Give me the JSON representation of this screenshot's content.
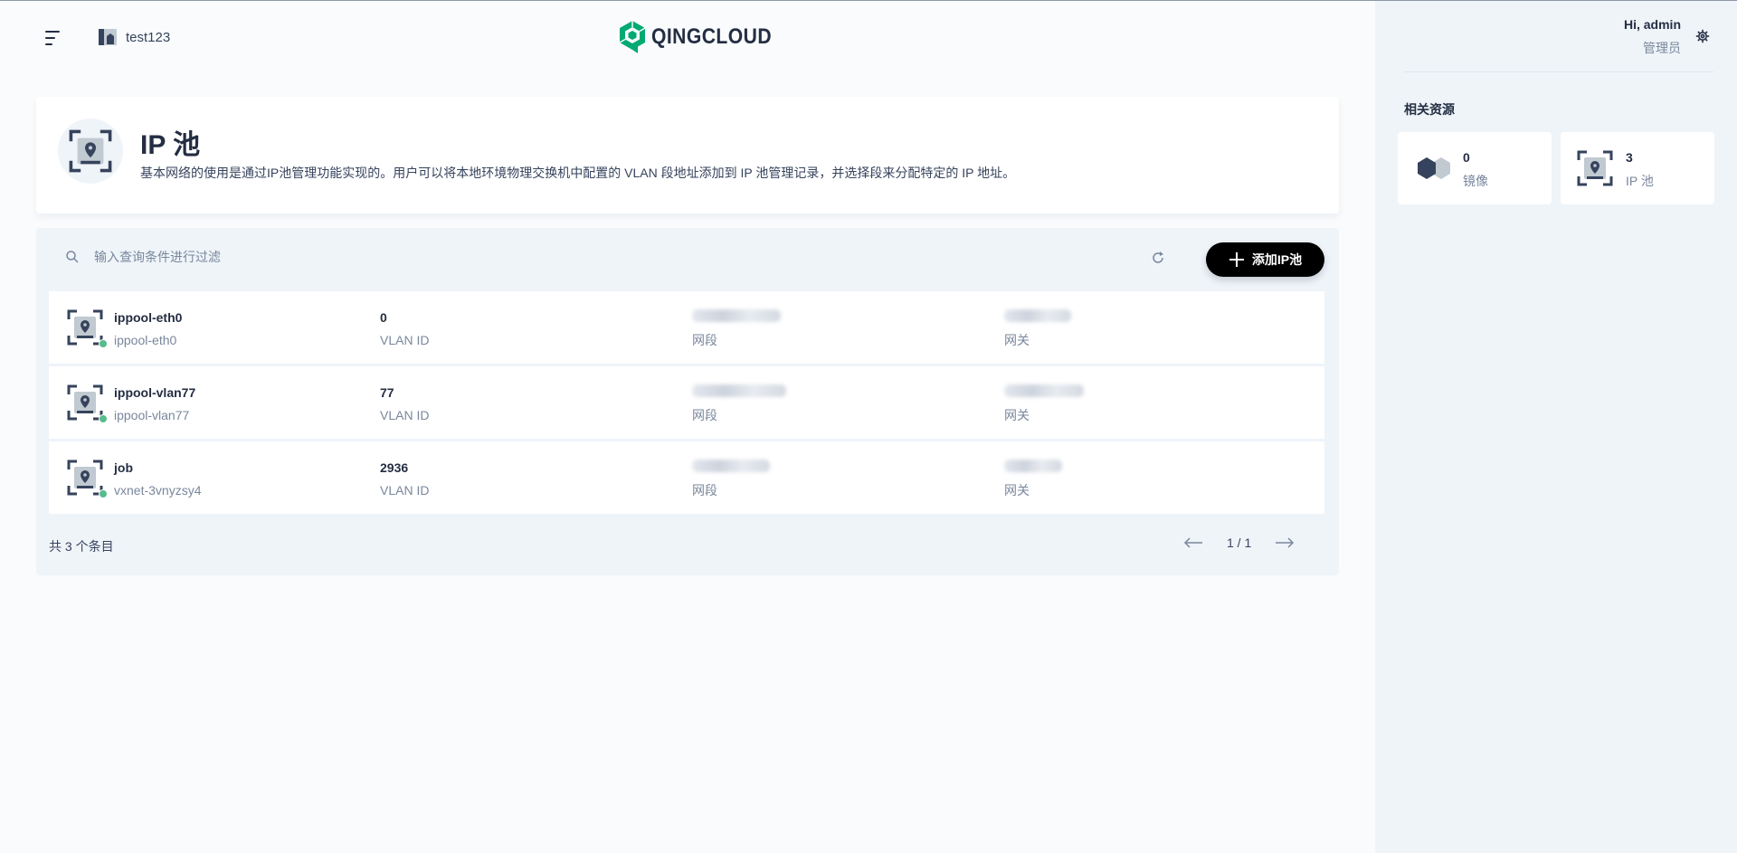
{
  "header": {
    "workspace": "test123",
    "logo_text": "QINGCLOUD"
  },
  "banner": {
    "title": "IP 池",
    "description": "基本网络的使用是通过IP池管理功能实现的。用户可以将本地环境物理交换机中配置的 VLAN 段地址添加到 IP 池管理记录，并选择段来分配特定的 IP 地址。"
  },
  "toolbar": {
    "search_placeholder": "输入查询条件进行过滤",
    "add_label": "添加IP池"
  },
  "columns": {
    "vlan": "VLAN ID",
    "segment": "网段",
    "gateway": "网关"
  },
  "rows": [
    {
      "name": "ippool-eth0",
      "sub": "ippool-eth0",
      "vlan": "0",
      "status": "active"
    },
    {
      "name": "ippool-vlan77",
      "sub": "ippool-vlan77",
      "vlan": "77",
      "status": "active"
    },
    {
      "name": "job",
      "sub": "vxnet-3vnyzsy4",
      "vlan": "2936",
      "status": "active"
    }
  ],
  "footer": {
    "total": "共 3 个条目",
    "page": "1 / 1"
  },
  "sidebar": {
    "greeting": "Hi, admin",
    "role": "管理员",
    "related_title": "相关资源",
    "resources": [
      {
        "count": "0",
        "label": "镜像",
        "icon": "image-hexagon-icon"
      },
      {
        "count": "3",
        "label": "IP 池",
        "icon": "ip-pool-icon"
      }
    ]
  },
  "colors": {
    "primary": "#242e42",
    "muted": "#79879c",
    "status_active": "#55bc8a",
    "brand": "#00aa72",
    "panel": "#eff4f9"
  }
}
